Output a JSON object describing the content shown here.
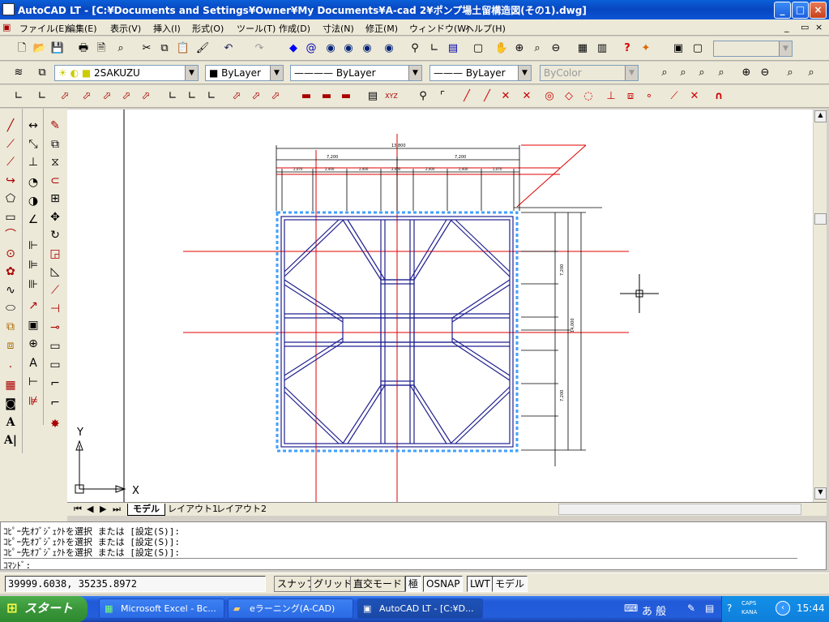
{
  "window": {
    "title": "AutoCAD LT - [C:¥Documents and Settings¥Owner¥My Documents¥A-cad 2¥ポンプ場土留構造図(その1).dwg]",
    "minimize": "_",
    "maximize": "□",
    "close": "×"
  },
  "menu": [
    "ファイル(E)",
    "編集(E)",
    "表示(V)",
    "挿入(I)",
    "形式(O)",
    "ツール(T)",
    "作成(D)",
    "寸法(N)",
    "修正(M)",
    "ウィンドウ(W)",
    "ヘルプ(H)"
  ],
  "toolbar": {
    "layer_combo": "2SAKUZU",
    "color_combo": "ByLayer",
    "linetype_combo": "ByLayer",
    "lineweight_combo": "ByLayer",
    "plotstyle_combo": "ByColor"
  },
  "drawing": {
    "ucs_y": "Y",
    "ucs_x": "X",
    "dim_top_total": "13,800",
    "dim_top_segments": [
      "7,200",
      "7,200"
    ],
    "dim_sub_segments": [
      "2,070",
      "2,400",
      "2,400",
      "2,400",
      "2,400",
      "2,400",
      "2,070"
    ],
    "dim_right_total": "14,000",
    "dim_right_segments": [
      "7,200",
      "7,200"
    ]
  },
  "tabs": [
    "モデル",
    "レイアウト1",
    "レイアウト2"
  ],
  "command_lines": [
    "ｺﾋﾟｰ先ｵﾌﾞｼﾞｪｸﾄを選択 または [設定(S)]:",
    "ｺﾋﾟｰ先ｵﾌﾞｼﾞｪｸﾄを選択 または [設定(S)]:",
    "ｺﾋﾟｰ先ｵﾌﾞｼﾞｪｸﾄを選択 または [設定(S)]:",
    "ｺﾏﾝﾄﾞ:"
  ],
  "status": {
    "coords": "39999.6038, 35235.8972",
    "buttons": [
      "スナップ",
      "グリッド",
      "直交モード",
      "極",
      "OSNAP",
      "LWT",
      "モデル"
    ]
  },
  "taskbar": {
    "start": "スタート",
    "tasks": [
      "Microsoft Excel - Bc...",
      "eラーニング(A-CAD)",
      "AutoCAD LT - [C:¥D..."
    ],
    "clock": "15:44",
    "ime": "あ 般",
    "caps": "CAPS",
    "kana": "KANA"
  },
  "colors": {
    "accent": "#0a5fd8",
    "axis_red": "#e00000",
    "steel_blue": "#202090",
    "sheet_pile": "#40a0ff"
  }
}
